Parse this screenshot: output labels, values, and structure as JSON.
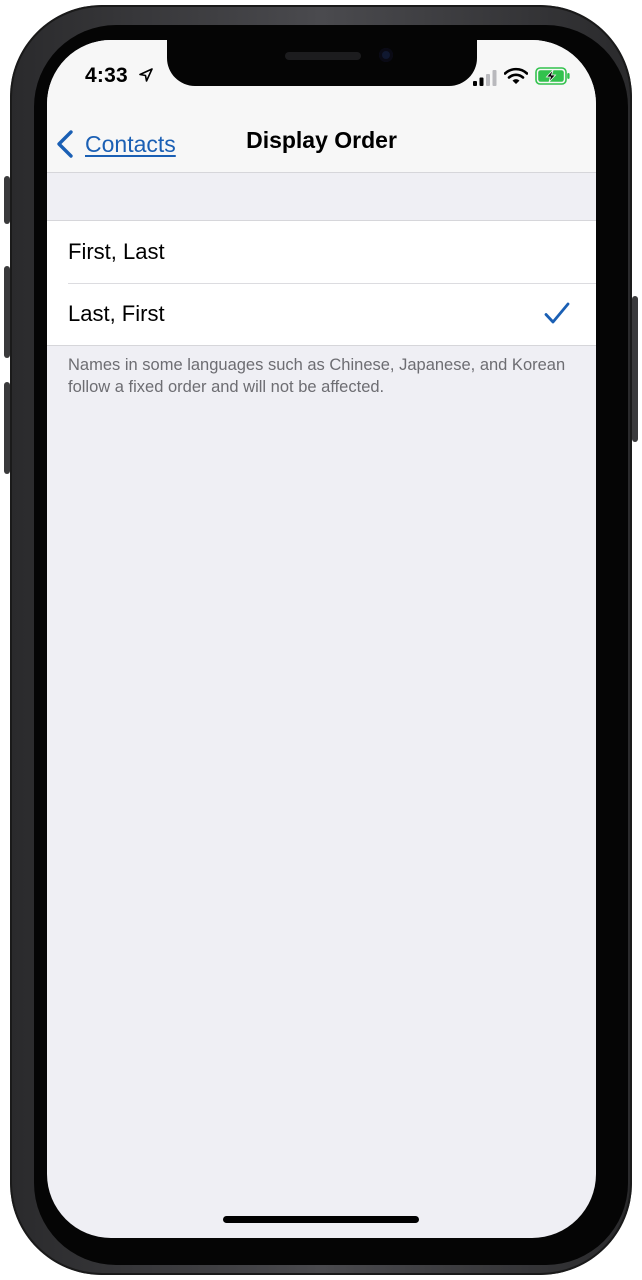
{
  "status_bar": {
    "time": "4:33",
    "icons": [
      "location-arrow-icon",
      "cellular-signal-icon",
      "wifi-icon",
      "battery-charging-icon"
    ]
  },
  "nav_bar": {
    "back_label": "Contacts",
    "back_icon": "chevron-left-icon",
    "title": "Display Order"
  },
  "options": [
    {
      "label": "First, Last",
      "selected": false
    },
    {
      "label": "Last, First",
      "selected": true
    }
  ],
  "footer_note": "Names in some languages such as Chinese, Japanese, and Korean follow a fixed order and will not be affected.",
  "colors": {
    "accent": "#1a5fb4",
    "background": "#efeff4",
    "battery_green": "#32c24d"
  }
}
